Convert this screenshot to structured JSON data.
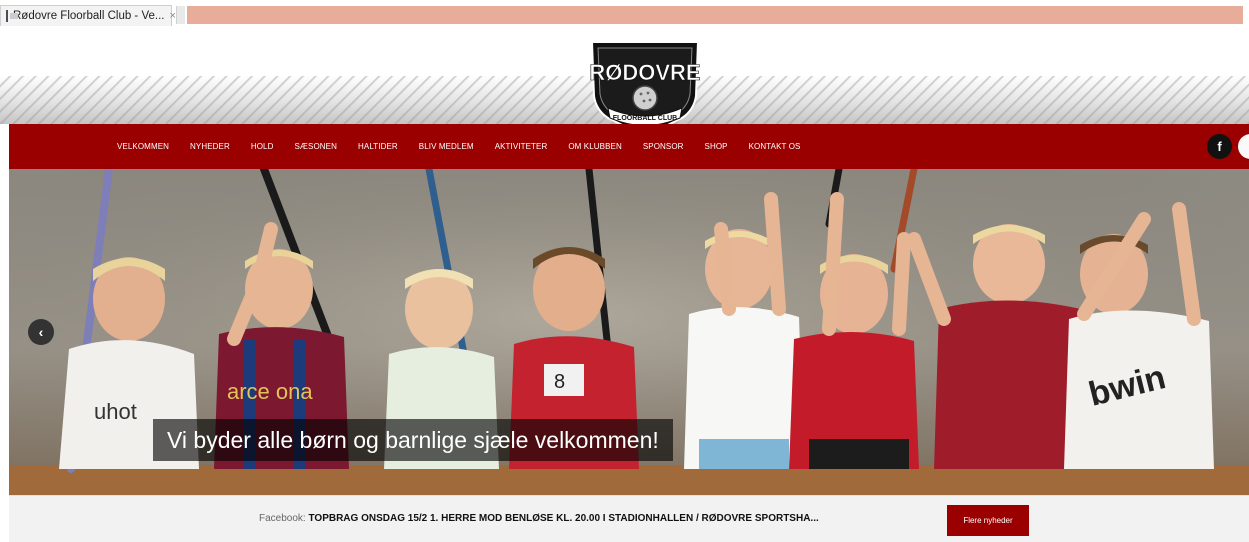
{
  "browser": {
    "tab_title": "Rødovre Floorball Club - Ve...",
    "tab_close": "×"
  },
  "logo": {
    "top_text": "RØDOVRE",
    "bottom_text": "FLOORBALL CLUB"
  },
  "nav": {
    "items": [
      {
        "label": "VELKOMMEN"
      },
      {
        "label": "NYHEDER"
      },
      {
        "label": "HOLD"
      },
      {
        "label": "SÆSONEN"
      },
      {
        "label": "HALTIDER"
      },
      {
        "label": "BLIV MEDLEM"
      },
      {
        "label": "AKTIVITETER"
      },
      {
        "label": "OM KLUBBEN"
      },
      {
        "label": "SPONSOR"
      },
      {
        "label": "SHOP"
      },
      {
        "label": "KONTAKT OS"
      }
    ],
    "facebook_icon_glyph": "f"
  },
  "hero": {
    "prev_arrow_glyph": "‹",
    "caption": "Vi byder alle børn og barnlige sjæle velkommen!",
    "shirt_texts": [
      "arce ona",
      "8",
      "bwin"
    ]
  },
  "ticker": {
    "source_label": "Facebook:",
    "headline": "TOPBRAG ONSDAG 15/2 1. HERRE MOD BENLØSE KL. 20.00 I STADIONHALLEN / RØDOVRE SPORTSHA...",
    "more_button": "Flere nyheder"
  },
  "colors": {
    "brand_red": "#9b0000",
    "tab_accent": "#e7ad9a",
    "ticker_bg": "#f2f2f2"
  }
}
